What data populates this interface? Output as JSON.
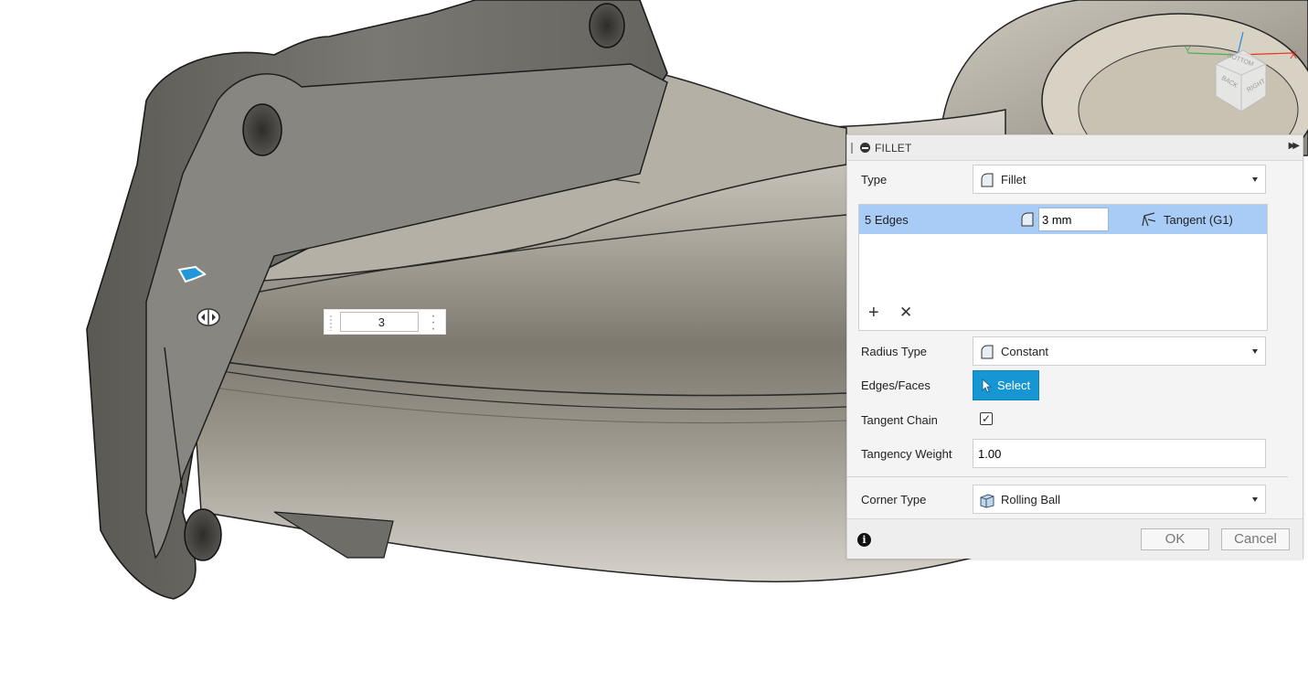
{
  "viewcube": {
    "labels": [
      "BOTTOM",
      "RIGHT",
      "BACK"
    ],
    "axes": {
      "x_color": "#e0382b",
      "y_color": "#4caf50",
      "z_color": "#1e88e5"
    }
  },
  "canvas_input": {
    "value": "3"
  },
  "panel": {
    "title": "FILLET",
    "type_label": "Type",
    "type_value": "Fillet",
    "edges": {
      "count_label": "5 Edges",
      "radius_value": "3 mm",
      "continuity": "Tangent (G1)"
    },
    "radius_type_label": "Radius Type",
    "radius_type_value": "Constant",
    "edges_faces_label": "Edges/Faces",
    "select_label": "Select",
    "tangent_chain_label": "Tangent Chain",
    "tangent_chain_checked": true,
    "tangency_weight_label": "Tangency Weight",
    "tangency_weight_value": "1.00",
    "corner_type_label": "Corner Type",
    "corner_type_value": "Rolling Ball",
    "ok_label": "OK",
    "cancel_label": "Cancel"
  },
  "colors": {
    "accent": "#1696d2",
    "selection": "#a8ccf5"
  }
}
